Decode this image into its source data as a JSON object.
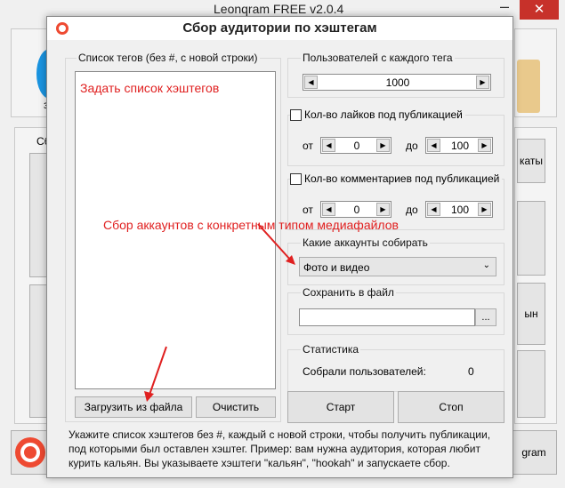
{
  "main_window": {
    "title": "Leonqram FREE v2.0.4",
    "right_button_1": "каты",
    "right_button_2": "ын",
    "bottom_button": "gram",
    "left_label_1": "з",
    "left_label_2": "Сб"
  },
  "dialog": {
    "title": "Сбор аудитории по хэштегам",
    "tags_group_label": "Список тегов (без #, с новой строки)",
    "tags_textarea_text": "Задать список хэштегов",
    "load_button": "Загрузить из файла",
    "clear_button": "Очистить",
    "users_per_tag": {
      "label": "Пользователей с каждого тега",
      "value": "1000"
    },
    "likes_filter": {
      "label": "Кол-во лайков под публикацией",
      "checked": false,
      "from_label": "от",
      "from_value": "0",
      "to_label": "до",
      "to_value": "100"
    },
    "comments_filter": {
      "label": "Кол-во комментариев под публикацией",
      "checked": false,
      "from_label": "от",
      "from_value": "0",
      "to_label": "до",
      "to_value": "100"
    },
    "account_type": {
      "label": "Какие аккаунты собирать",
      "selected": "Фото и видео"
    },
    "save_file": {
      "label": "Сохранить в файл",
      "value": "",
      "browse_label": "..."
    },
    "stats": {
      "label": "Статистика",
      "collected_label": "Собрали пользователей:",
      "collected_value": "0"
    },
    "start_button": "Старт",
    "stop_button": "Стоп",
    "help_text": "Укажите список хэштегов без #, каждый с новой строки, чтобы получить публикации, под которыми был оставлен хэштег. Пример: вам нужна аудитория, которая любит курить кальян. Вы указываете хэштеги \"кальян\", \"hookah\" и запускаете сбор."
  },
  "annotations": {
    "media_type_note": "Сбор аккаунтов с конкретным типом медиафайлов"
  },
  "colors": {
    "annotation_red": "#e02020",
    "logo_orange": "#ee4a32",
    "close_red": "#c7312a"
  }
}
